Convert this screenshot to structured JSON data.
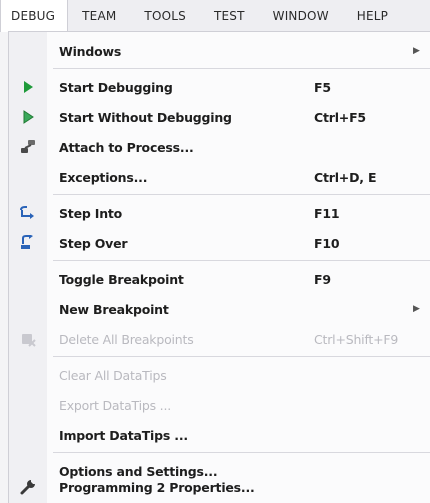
{
  "menubar": {
    "items": [
      "DEBUG",
      "TEAM",
      "TOOLS",
      "TEST",
      "WINDOW",
      "HELP"
    ]
  },
  "menu": {
    "windows": {
      "label": "Windows"
    },
    "start_debugging": {
      "label": "Start Debugging",
      "shortcut": "F5",
      "icon": "play-icon"
    },
    "start_without_debugging": {
      "label": "Start Without Debugging",
      "shortcut": "Ctrl+F5",
      "icon": "play-outline-icon"
    },
    "attach_to_process": {
      "label": "Attach to Process...",
      "icon": "attach-process-icon"
    },
    "exceptions": {
      "label": "Exceptions...",
      "shortcut": "Ctrl+D, E"
    },
    "step_into": {
      "label": "Step Into",
      "shortcut": "F11",
      "icon": "step-into-icon"
    },
    "step_over": {
      "label": "Step Over",
      "shortcut": "F10",
      "icon": "step-over-icon"
    },
    "toggle_breakpoint": {
      "label": "Toggle Breakpoint",
      "shortcut": "F9"
    },
    "new_breakpoint": {
      "label": "New Breakpoint"
    },
    "delete_all_breakpoints": {
      "label": "Delete All Breakpoints",
      "shortcut": "Ctrl+Shift+F9",
      "icon": "delete-breakpoints-icon",
      "disabled": true
    },
    "clear_all_datatips": {
      "label": "Clear All DataTips",
      "disabled": true
    },
    "export_datatips": {
      "label": "Export DataTips ...",
      "disabled": true
    },
    "import_datatips": {
      "label": "Import DataTips ..."
    },
    "options_and_settings": {
      "label": "Options and Settings..."
    },
    "programming_properties": {
      "label": "Programming 2 Properties...",
      "icon": "wrench-icon"
    }
  },
  "colors": {
    "play_green": "#1f9a3a",
    "step_blue": "#2a63b8",
    "disabled_text": "#b9b9bf"
  }
}
